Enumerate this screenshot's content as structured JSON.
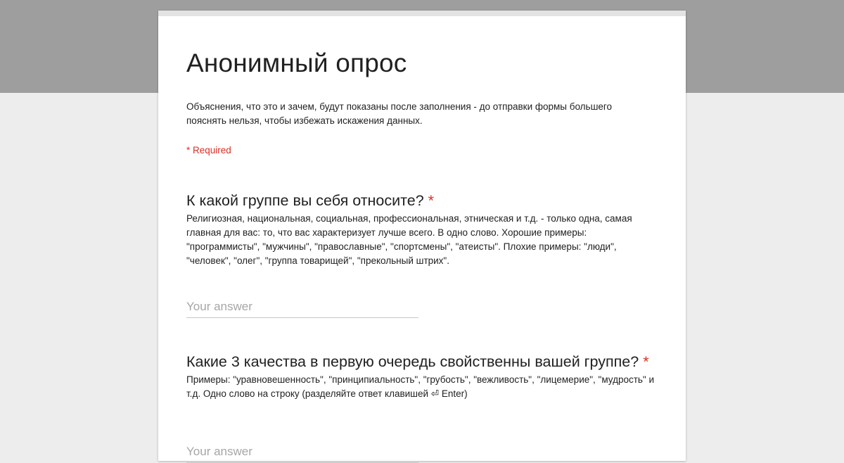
{
  "colors": {
    "header_band": "#9e9e9e",
    "page_background": "#ededed",
    "card_background": "#ffffff",
    "required": "#d93025",
    "text": "#212121",
    "placeholder": "#a6a6a6"
  },
  "form": {
    "title": "Анонимный опрос",
    "description": "Объяснения, что это и зачем, будут показаны после заполнения - до отправки формы большего пояснять нельзя, чтобы избежать искажения данных.",
    "required_note": "* Required"
  },
  "questions": [
    {
      "title": "К какой группе вы себя относите?",
      "required_mark": "*",
      "help": "Религиозная, национальная, социальная, профессиональная, этническая и т.д. - только одна, самая главная для вас: то, что вас характеризует лучше всего. В одно слово. Хорошие примеры: \"программисты\", \"мужчины\", \"православные\", \"спортсмены\", \"атеисты\". Плохие примеры: \"люди\", \"человек\", \"олег\", \"группа товарищей\", \"прекольный штрих\".",
      "answer_placeholder": "Your answer",
      "answer_value": ""
    },
    {
      "title": "Какие 3 качества в первую очередь свойственны вашей группе?",
      "required_mark": "*",
      "help": "Примеры: \"уравновешенность\", \"принципиальность\", \"грубость\", \"вежливость\", \"лицемерие\", \"мудрость\" и т.д. Одно слово на строку (разделяйте ответ клавишей ⏎ Enter)",
      "answer_placeholder": "Your answer",
      "answer_value": ""
    }
  ]
}
